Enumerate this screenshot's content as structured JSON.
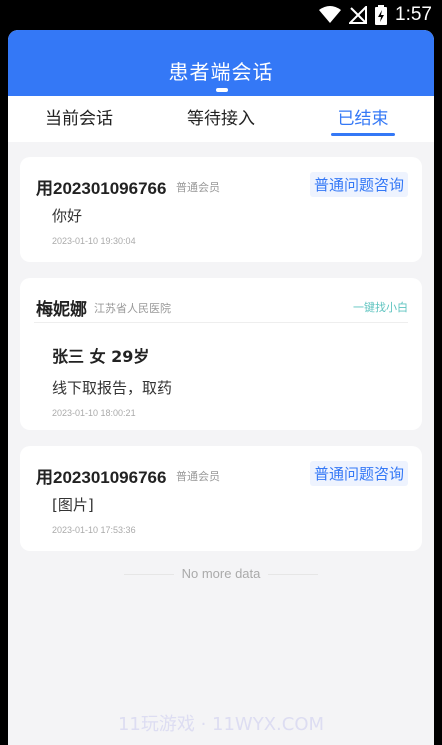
{
  "status_bar": {
    "time": "1:57"
  },
  "header": {
    "title": "患者端会话"
  },
  "tabs": [
    {
      "label": "当前会话",
      "active": false
    },
    {
      "label": "等待接入",
      "active": false
    },
    {
      "label": "已结束",
      "active": true
    }
  ],
  "conversations": [
    {
      "name": "用202301096766",
      "member_type": "普通会员",
      "tag": "普通问题咨询",
      "message": "你好",
      "time": "2023-01-10 19:30:04"
    },
    {
      "name": "梅妮娜",
      "org": "江苏省人民医院",
      "tag": "一键找小白",
      "patient": "张三 女 29岁",
      "message": "线下取报告，取药",
      "time": "2023-01-10 18:00:21"
    },
    {
      "name": "用202301096766",
      "member_type": "普通会员",
      "tag": "普通问题咨询",
      "message": "[图片]",
      "time": "2023-01-10 17:53:36"
    }
  ],
  "footer": {
    "no_more": "No more data"
  },
  "watermark": "11玩游戏 · 11WYX.COM",
  "colors": {
    "primary": "#3478f6",
    "teal": "#5fc4c0"
  }
}
